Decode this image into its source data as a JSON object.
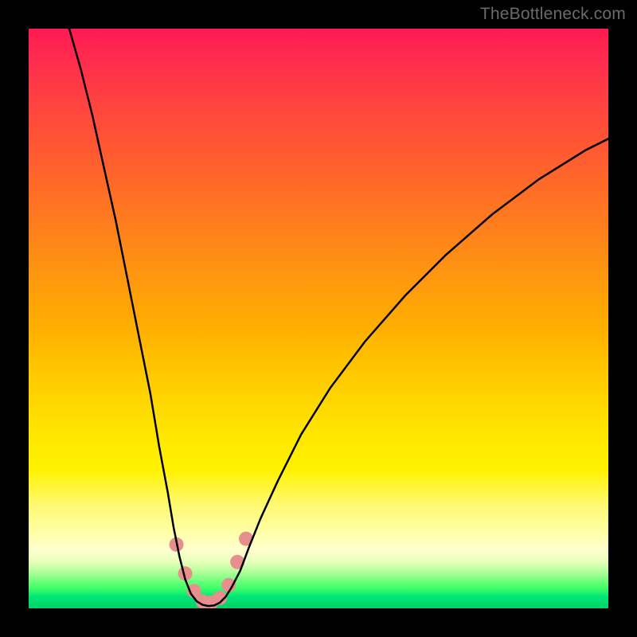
{
  "watermark": "TheBottleneck.com",
  "chart_data": {
    "type": "line",
    "title": "",
    "xlabel": "",
    "ylabel": "",
    "xlim": [
      0,
      100
    ],
    "ylim": [
      0,
      100
    ],
    "grid": false,
    "background": {
      "gradient_stops": [
        {
          "pct": 0,
          "color": "#ff1a53"
        },
        {
          "pct": 12,
          "color": "#ff4040"
        },
        {
          "pct": 28,
          "color": "#ff6d26"
        },
        {
          "pct": 44,
          "color": "#ff9a0d"
        },
        {
          "pct": 58,
          "color": "#ffc400"
        },
        {
          "pct": 70,
          "color": "#ffe600"
        },
        {
          "pct": 82,
          "color": "#fff970"
        },
        {
          "pct": 90,
          "color": "#ffffd0"
        },
        {
          "pct": 95,
          "color": "#7cff82"
        },
        {
          "pct": 100,
          "color": "#00d26a"
        }
      ]
    },
    "curve": {
      "color": "#000000",
      "width": 2.5,
      "points_xy_0to100": [
        [
          7,
          100
        ],
        [
          9,
          93
        ],
        [
          11,
          85
        ],
        [
          13,
          76
        ],
        [
          15,
          67
        ],
        [
          17,
          57
        ],
        [
          19,
          47
        ],
        [
          21,
          37
        ],
        [
          22.5,
          28
        ],
        [
          24,
          20
        ],
        [
          25,
          14
        ],
        [
          26,
          9
        ],
        [
          27,
          5
        ],
        [
          28,
          2.5
        ],
        [
          29,
          1.2
        ],
        [
          30,
          0.6
        ],
        [
          31,
          0.4
        ],
        [
          32,
          0.5
        ],
        [
          33,
          1.0
        ],
        [
          34,
          2.0
        ],
        [
          35,
          3.6
        ],
        [
          36.5,
          6.5
        ],
        [
          38,
          10.5
        ],
        [
          40,
          15.5
        ],
        [
          43,
          22
        ],
        [
          47,
          30
        ],
        [
          52,
          38
        ],
        [
          58,
          46
        ],
        [
          65,
          54
        ],
        [
          72,
          61
        ],
        [
          80,
          68
        ],
        [
          88,
          74
        ],
        [
          96,
          79
        ],
        [
          100,
          81
        ]
      ]
    },
    "drift_markers": {
      "color": "#e78f8f",
      "radius_px": 9,
      "points_xy_0to100": [
        [
          25.5,
          11
        ],
        [
          27,
          6
        ],
        [
          28.5,
          3
        ],
        [
          30,
          1.2
        ],
        [
          31.5,
          1.0
        ],
        [
          33,
          1.8
        ],
        [
          34.5,
          4
        ],
        [
          36,
          8
        ],
        [
          37.5,
          12
        ]
      ]
    }
  }
}
